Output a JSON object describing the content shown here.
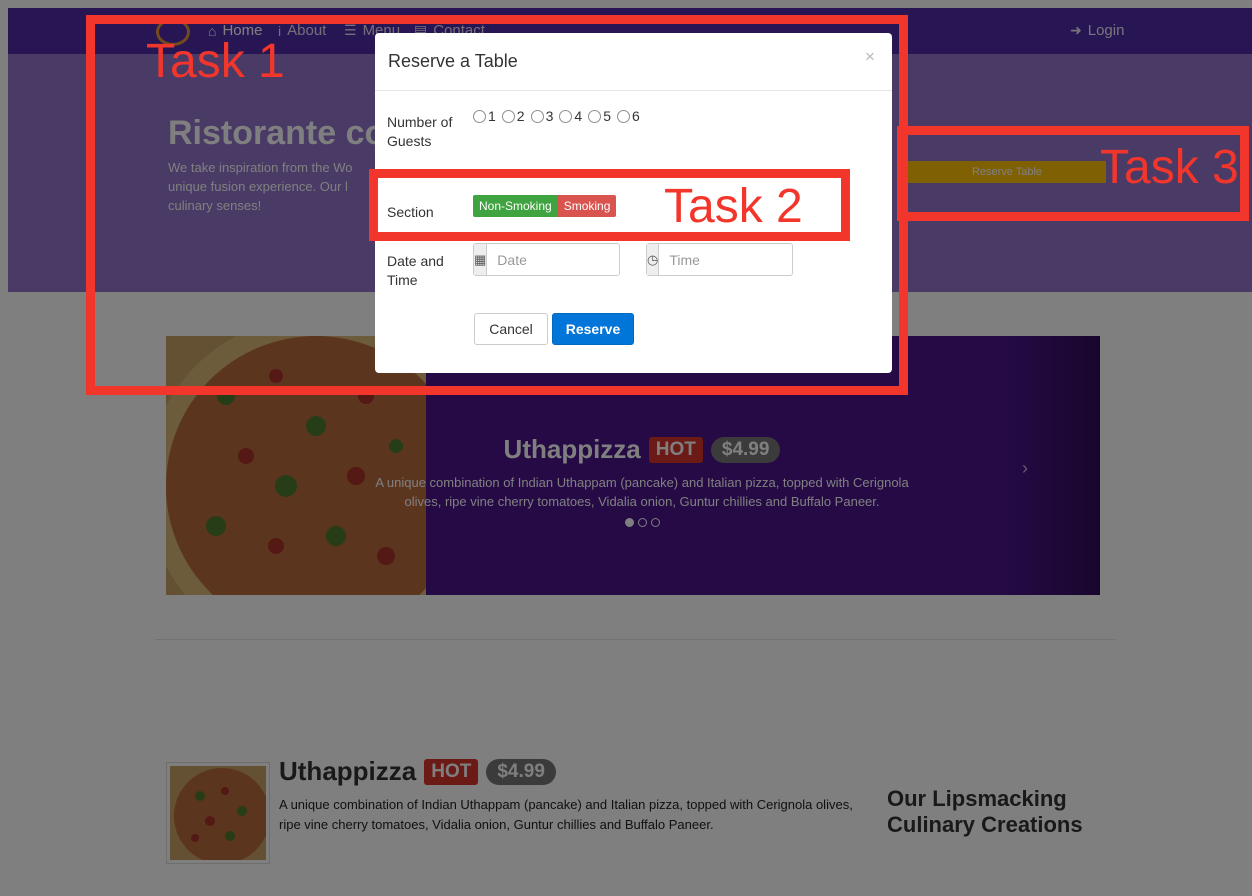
{
  "navbar": {
    "items": [
      {
        "label": "Home",
        "icon": "home-icon"
      },
      {
        "label": "About",
        "icon": "info-icon"
      },
      {
        "label": "Menu",
        "icon": "list-icon"
      },
      {
        "label": "Contact",
        "icon": "address-card-icon"
      }
    ],
    "login_label": "Login"
  },
  "jumbotron": {
    "title": "Ristorante co",
    "text": "We take inspiration from the Wo unique fusion experience. Our l culinary senses!",
    "reserve_button": "Reserve Table"
  },
  "carousel": {
    "title": "Uthappizza",
    "badge_hot": "HOT",
    "badge_price": "$4.99",
    "description": "A unique combination of Indian Uthappam (pancake) and Italian pizza, topped with Cerignola olives, ripe vine cherry tomatoes, Vidalia onion, Guntur chillies and Buffalo Paneer.",
    "next_glyph": "›",
    "dots": 3,
    "active_dot": 0
  },
  "featured": {
    "title": "Uthappizza",
    "badge_hot": "HOT",
    "badge_price": "$4.99",
    "description": "A unique combination of Indian Uthappam (pancake) and Italian pizza, topped with Cerignola olives, ripe vine cherry tomatoes, Vidalia onion, Guntur chillies and Buffalo Paneer.",
    "side_heading": "Our Lipsmacking Culinary Creations"
  },
  "modal": {
    "title": "Reserve a Table",
    "close_glyph": "×",
    "guests_label": "Number of Guests",
    "guest_options": [
      "1",
      "2",
      "3",
      "4",
      "5",
      "6"
    ],
    "section_label": "Section",
    "section_options": [
      "Non-Smoking",
      "Smoking"
    ],
    "datetime_label": "Date and Time",
    "date_placeholder": "Date",
    "time_placeholder": "Time",
    "cancel_label": "Cancel",
    "reserve_label": "Reserve"
  },
  "annotations": {
    "task1": "Task 1",
    "task2": "Task 2",
    "task3": "Task 3"
  },
  "colors": {
    "primary": "#512da8",
    "jumbotron": "#9575cd",
    "accent": "#ffc107",
    "annotation": "#f2362b"
  }
}
